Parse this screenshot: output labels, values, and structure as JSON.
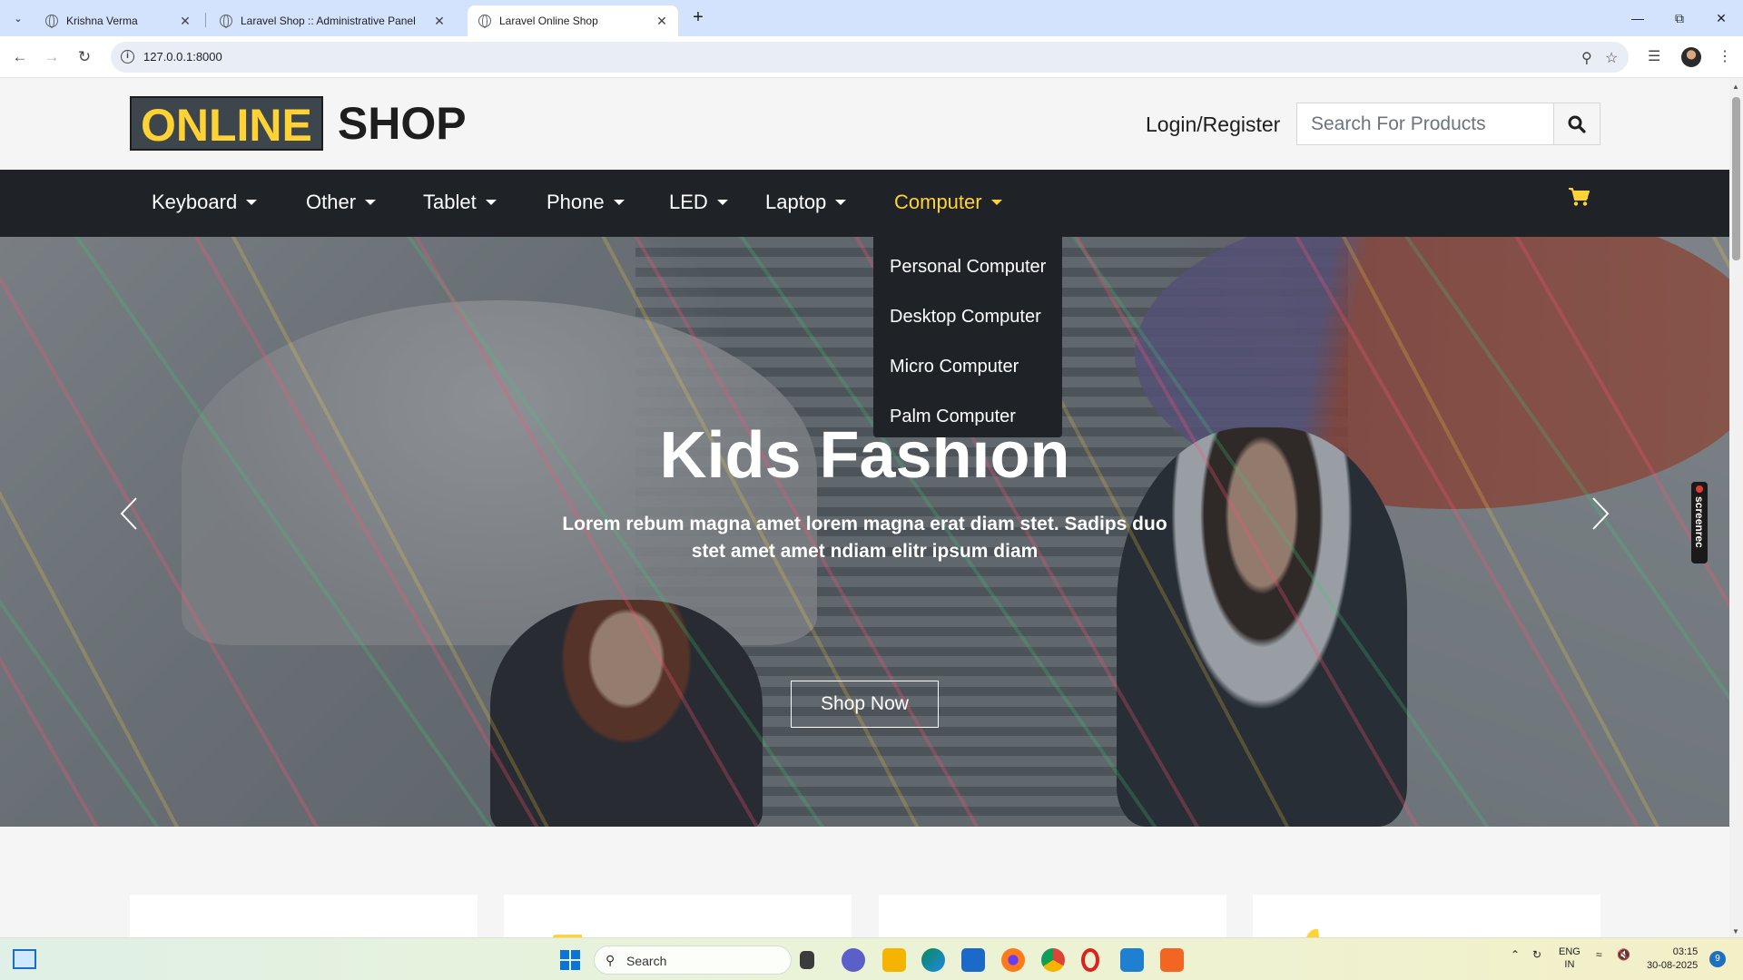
{
  "browser": {
    "tabs": [
      {
        "title": "Krishna Verma"
      },
      {
        "title": "Laravel Shop :: Administrative Panel"
      },
      {
        "title": "Laravel Online Shop"
      }
    ],
    "url": "127.0.0.1:8000"
  },
  "header": {
    "logo_highlight": "ONLINE",
    "logo_rest": "SHOP",
    "login_label": "Login/Register",
    "search_placeholder": "Search For Products"
  },
  "nav": {
    "items": [
      {
        "label": "Keyboard"
      },
      {
        "label": "Other"
      },
      {
        "label": "Tablet"
      },
      {
        "label": "Phone"
      },
      {
        "label": "LED"
      },
      {
        "label": "Laptop"
      },
      {
        "label": "Computer"
      }
    ],
    "active_index": 6,
    "dropdown": [
      "Personal Computer",
      "Desktop Computer",
      "Micro Computer",
      "Palm Computer"
    ]
  },
  "hero": {
    "title": "Kids Fashion",
    "text": "Lorem rebum magna amet lorem magna erat diam stet. Sadips duo stet amet amet ndiam elitr ipsum diam",
    "button": "Shop Now"
  },
  "overlay": {
    "screenrec": "screenrec"
  },
  "taskbar": {
    "search_label": "Search",
    "lang_line1": "ENG",
    "lang_line2": "IN",
    "time": "03:15",
    "date": "30-08-2025",
    "notification_count": "9"
  },
  "colors": {
    "accent": "#ffd333",
    "navbar": "#1f2327",
    "text_dark": "#1e1e1e"
  }
}
